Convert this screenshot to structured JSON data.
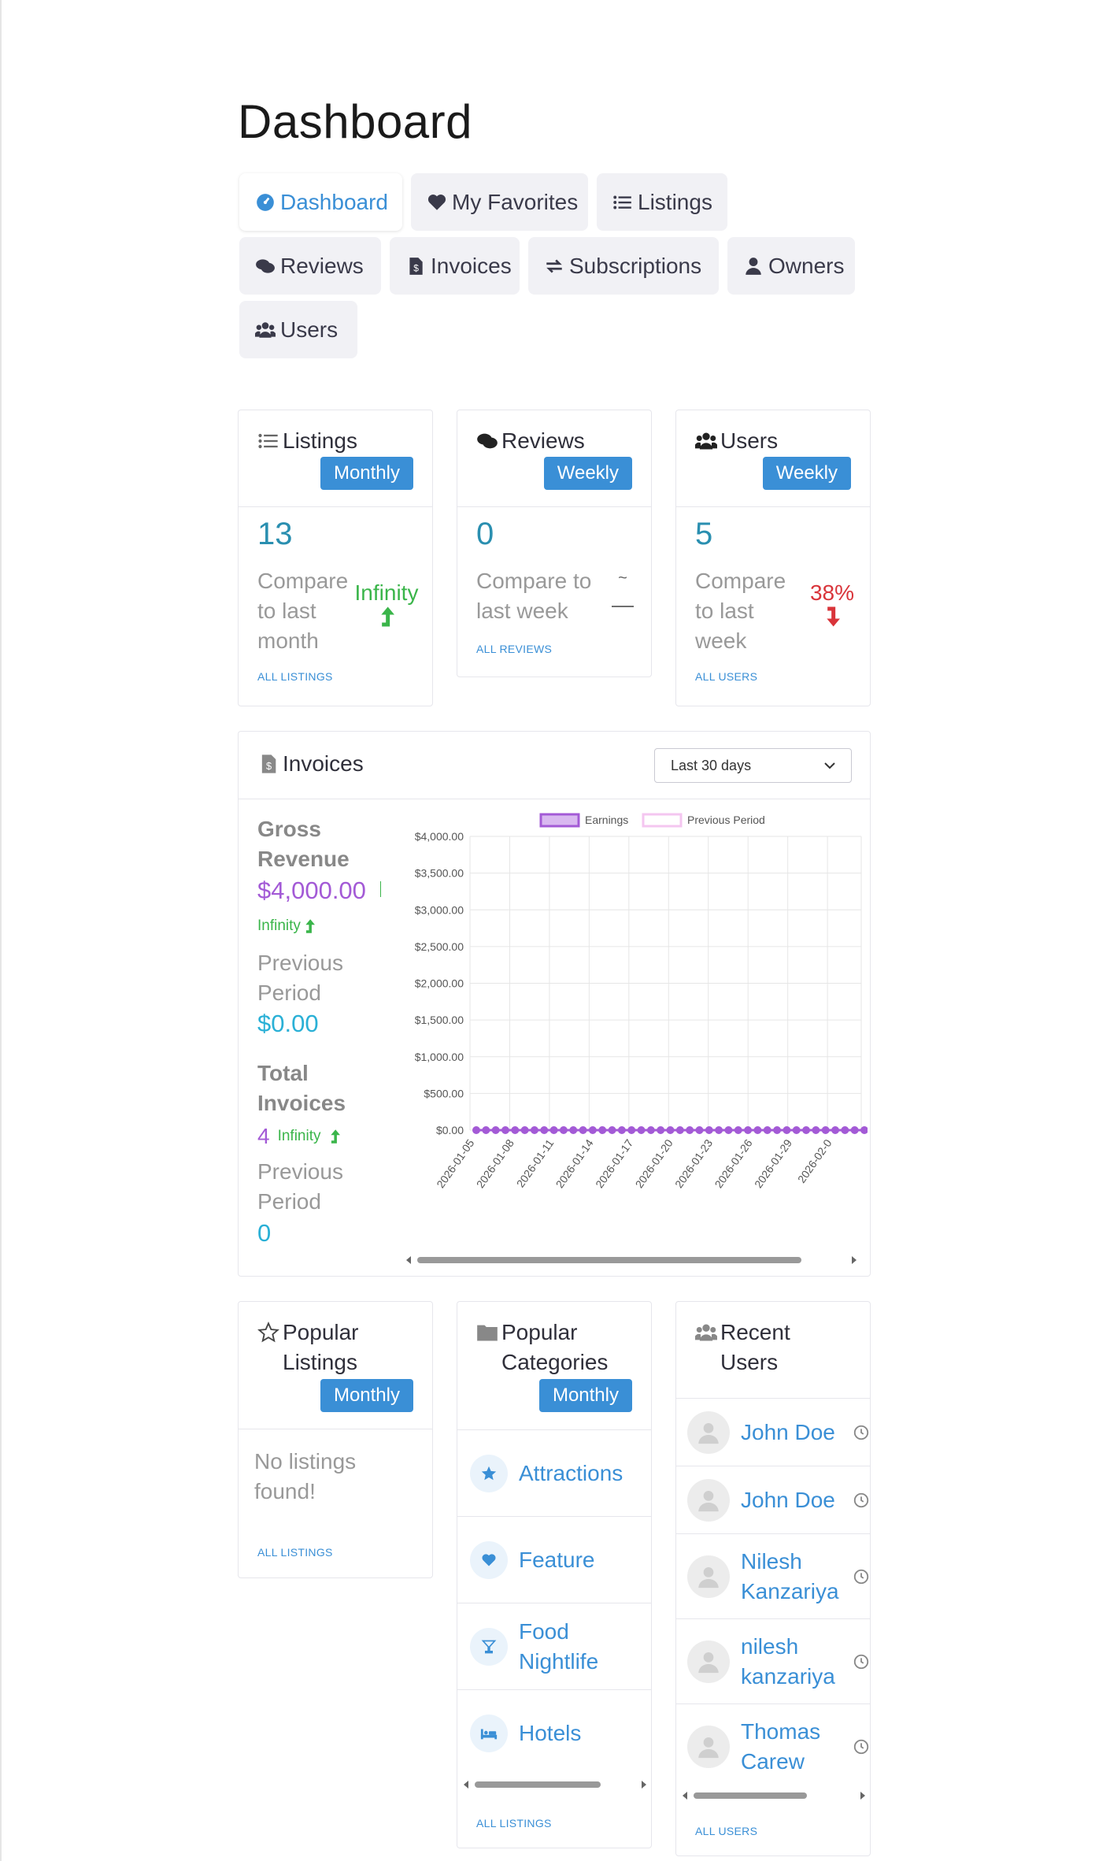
{
  "page_title": "Dashboard",
  "nav": {
    "tabs": [
      {
        "label": "Dashboard",
        "icon": "dashboard-icon"
      },
      {
        "label": "My Favorites",
        "icon": "heart-icon"
      },
      {
        "label": "Listings",
        "icon": "list-icon"
      },
      {
        "label": "Reviews",
        "icon": "comments-icon"
      },
      {
        "label": "Invoices",
        "icon": "invoice-icon"
      },
      {
        "label": "Subscriptions",
        "icon": "sync-icon"
      },
      {
        "label": "Owners",
        "icon": "user-icon"
      },
      {
        "label": "Users",
        "icon": "users-icon"
      }
    ]
  },
  "stats": {
    "listings": {
      "title": "Listings",
      "period": "Monthly",
      "value": "13",
      "compare": "Compare to last month",
      "delta": "Infinity",
      "link": "ALL LISTINGS"
    },
    "reviews": {
      "title": "Reviews",
      "period": "Weekly",
      "value": "0",
      "compare": "Compare to last week",
      "delta_top": "~",
      "delta": "—",
      "link": "ALL REVIEWS"
    },
    "users": {
      "title": "Users",
      "period": "Weekly",
      "value": "5",
      "compare": "Compare to last week",
      "delta": "38%",
      "link": "ALL USERS"
    }
  },
  "invoices": {
    "title": "Invoices",
    "range_select": "Last 30 days",
    "gross_revenue_label": "Gross Revenue",
    "gross_revenue_value": "$4,000.00",
    "gross_revenue_delta": "Infinity",
    "prev_period_label": "Previous Period",
    "prev_period_value": "$0.00",
    "total_invoices_label": "Total Invoices",
    "total_invoices_value": "4",
    "total_invoices_delta": "Infinity",
    "prev_period_label_2": "Previous Period",
    "prev_period_value_2": "0"
  },
  "chart_data": {
    "type": "line",
    "legend": [
      "Earnings",
      "Previous Period"
    ],
    "legend_position": "top",
    "x_tick_labels": [
      "2026-01-05",
      "2026-01-08",
      "2026-01-11",
      "2026-01-14",
      "2026-01-17",
      "2026-01-20",
      "2026-01-23",
      "2026-01-26",
      "2026-01-29",
      "2026-02-0"
    ],
    "y_tick_labels": [
      "$0.00",
      "$500.00",
      "$1,000.00",
      "$1,500.00",
      "$2,000.00",
      "$2,500.00",
      "$3,000.00",
      "$3,500.00",
      "$4,000.00"
    ],
    "ylim": [
      0,
      4000
    ],
    "grid": true,
    "series": [
      {
        "name": "Earnings",
        "color": "#a35ad6",
        "values": [
          0,
          0,
          0,
          0,
          0,
          0,
          0,
          0,
          0,
          0,
          0,
          0,
          0,
          0,
          0,
          0,
          0,
          0,
          0,
          0,
          0,
          0,
          0,
          0,
          0,
          0,
          0,
          0,
          0,
          0,
          0,
          0,
          0,
          0,
          0,
          0,
          0,
          0,
          0,
          0,
          0
        ]
      }
    ]
  },
  "popular_listings": {
    "title": "Popular Listings",
    "period": "Monthly",
    "empty": "No listings found!",
    "link": "ALL LISTINGS"
  },
  "popular_categories": {
    "title": "Popular Categories",
    "period": "Monthly",
    "items": [
      {
        "label": "Attractions",
        "icon": "star-icon"
      },
      {
        "label": "Feature",
        "icon": "heart-icon"
      },
      {
        "label": "Food Nightlife",
        "icon": "cocktail-icon"
      },
      {
        "label": "Hotels",
        "icon": "bed-icon"
      }
    ],
    "link": "ALL LISTINGS"
  },
  "recent_users": {
    "title": "Recent Users",
    "items": [
      {
        "name": "John Doe"
      },
      {
        "name": "John Doe"
      },
      {
        "name": "Nilesh Kanzariya"
      },
      {
        "name": "nilesh kanzariya"
      },
      {
        "name": "Thomas Carew"
      }
    ],
    "link": "ALL USERS"
  },
  "colors": {
    "accent": "#3a8fd6",
    "teal": "#2a8fb0",
    "green": "#3ab54a",
    "red": "#d9343a",
    "purple": "#a35ad6"
  }
}
